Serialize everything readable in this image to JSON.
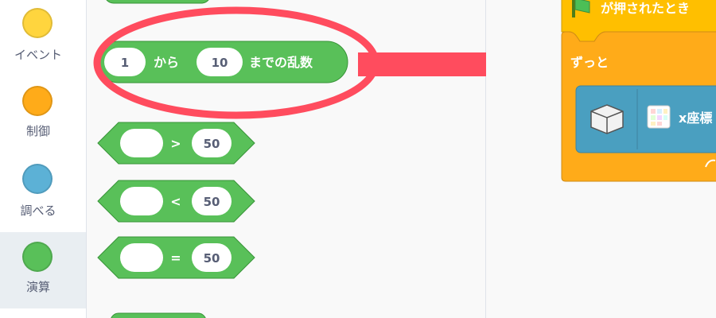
{
  "sidebar": {
    "categories": [
      {
        "label": "イベント",
        "color": "#ffd53e"
      },
      {
        "label": "制御",
        "color": "#ffab19"
      },
      {
        "label": "調べる",
        "color": "#5cb1d6"
      },
      {
        "label": "演算",
        "color": "#59c059"
      }
    ]
  },
  "palette": {
    "random_block": {
      "from": "1",
      "word_from": "から",
      "to": "10",
      "word_to": "までの乱数"
    },
    "gt_block": {
      "operator": ">",
      "value": "50"
    },
    "lt_block": {
      "operator": "<",
      "value": "50"
    },
    "eq_block": {
      "operator": "=",
      "value": "50"
    }
  },
  "workspace": {
    "hat_block": {
      "label": "が押されたとき"
    },
    "forever_block": {
      "label": "ずっと"
    },
    "inner_block": {
      "label": "x座標"
    }
  },
  "colors": {
    "operators": "#59c059",
    "control": "#ffab19",
    "events": "#ffbf00",
    "sensing": "#4a9fc0",
    "highlight": "#ff4c5e"
  }
}
